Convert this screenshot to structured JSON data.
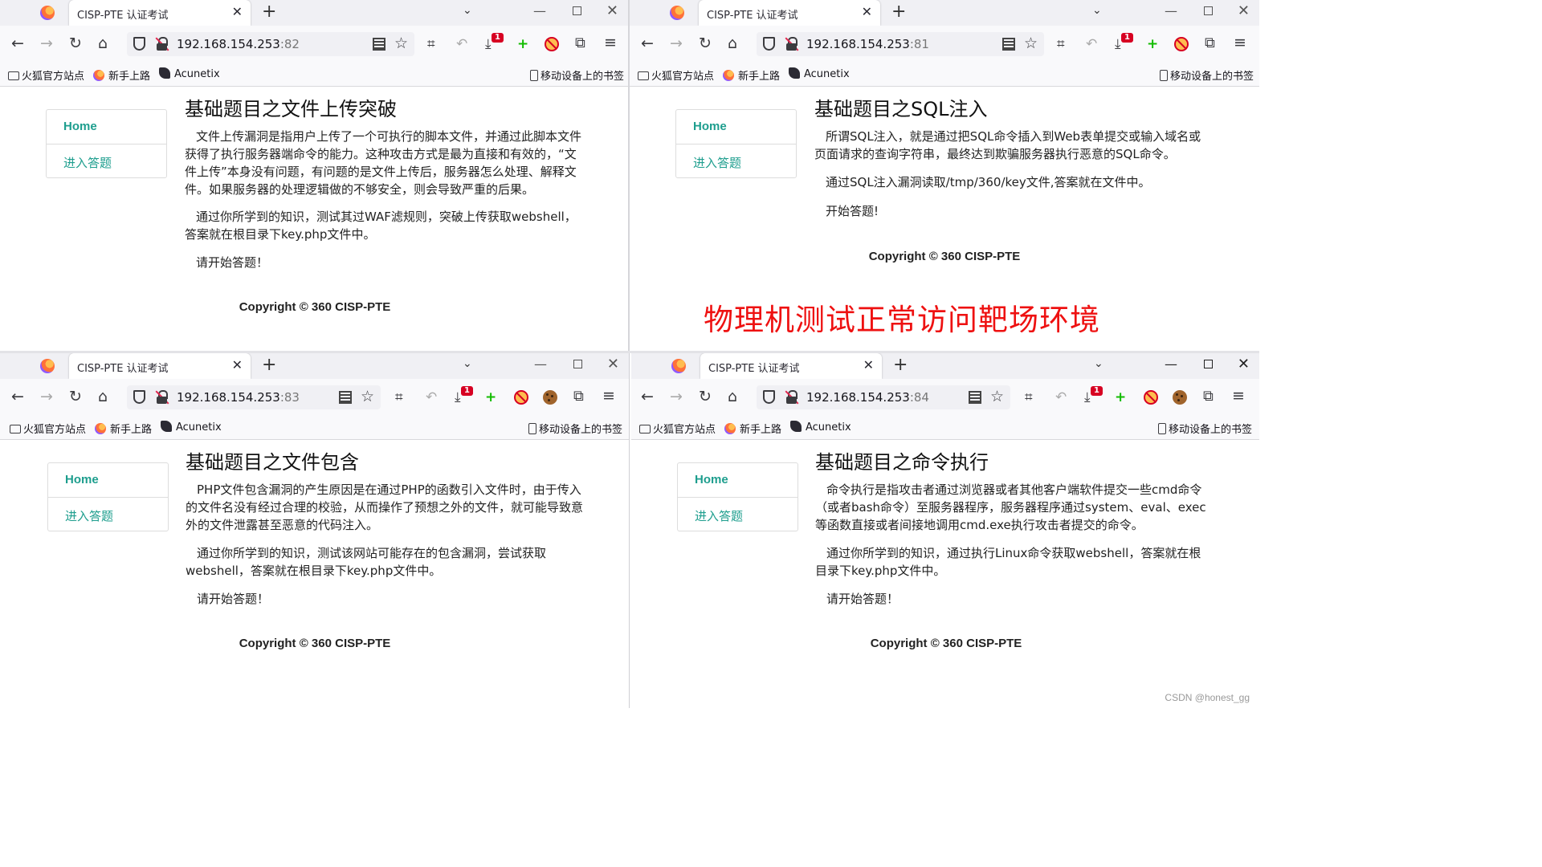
{
  "tab_title": "CISP-PTE 认证考试",
  "bookmarks": {
    "item1": "火狐官方站点",
    "item2": "新手上路",
    "item3": "Acunetix",
    "mobile": "移动设备上的书签"
  },
  "sidenav": {
    "home": "Home",
    "exam": "进入答题"
  },
  "copyright": "Copyright © 360 CISP-PTE",
  "notification_badge": "1",
  "windows": [
    {
      "host": "192.168.154.253",
      "port": ":82",
      "heading": "基础题目之文件上传突破",
      "paragraphs": [
        "文件上传漏洞是指用户上传了一个可执行的脚本文件，并通过此脚本文件获得了执行服务器端命令的能力。这种攻击方式是最为直接和有效的，“文件上传”本身没有问题，有问题的是文件上传后，服务器怎么处理、解释文件。如果服务器的处理逻辑做的不够安全，则会导致严重的后果。",
        "通过你所学到的知识，测试其过WAF滤规则，突破上传获取webshell，答案就在根目录下key.php文件中。",
        "请开始答题！"
      ]
    },
    {
      "host": "192.168.154.253",
      "port": ":81",
      "heading": "基础题目之SQL注入",
      "paragraphs": [
        "所谓SQL注入，就是通过把SQL命令插入到Web表单提交或输入域名或页面请求的查询字符串，最终达到欺骗服务器执行恶意的SQL命令。",
        "通过SQL注入漏洞读取/tmp/360/key文件,答案就在文件中。",
        "开始答题!"
      ]
    },
    {
      "host": "192.168.154.253",
      "port": ":83",
      "heading": "基础题目之文件包含",
      "paragraphs": [
        "PHP文件包含漏洞的产生原因是在通过PHP的函数引入文件时，由于传入的文件名没有经过合理的校验，从而操作了预想之外的文件，就可能导致意外的文件泄露甚至恶意的代码注入。",
        "通过你所学到的知识，测试该网站可能存在的包含漏洞，尝试获取webshell，答案就在根目录下key.php文件中。",
        "请开始答题！"
      ]
    },
    {
      "host": "192.168.154.253",
      "port": ":84",
      "heading": "基础题目之命令执行",
      "paragraphs": [
        "命令执行是指攻击者通过浏览器或者其他客户端软件提交一些cmd命令（或者bash命令）至服务器程序，服务器程序通过system、eval、exec等函数直接或者间接地调用cmd.exe执行攻击者提交的命令。",
        "通过你所学到的知识，通过执行Linux命令获取webshell，答案就在根目录下key.php文件中。",
        "请开始答题！"
      ]
    }
  ],
  "overlay_note": "物理机测试正常访问靶场环境",
  "watermark": "CSDN @honest_gg",
  "colors": {
    "link": "#1e9e8e",
    "note": "#ee1111",
    "badge": "#d70022"
  }
}
